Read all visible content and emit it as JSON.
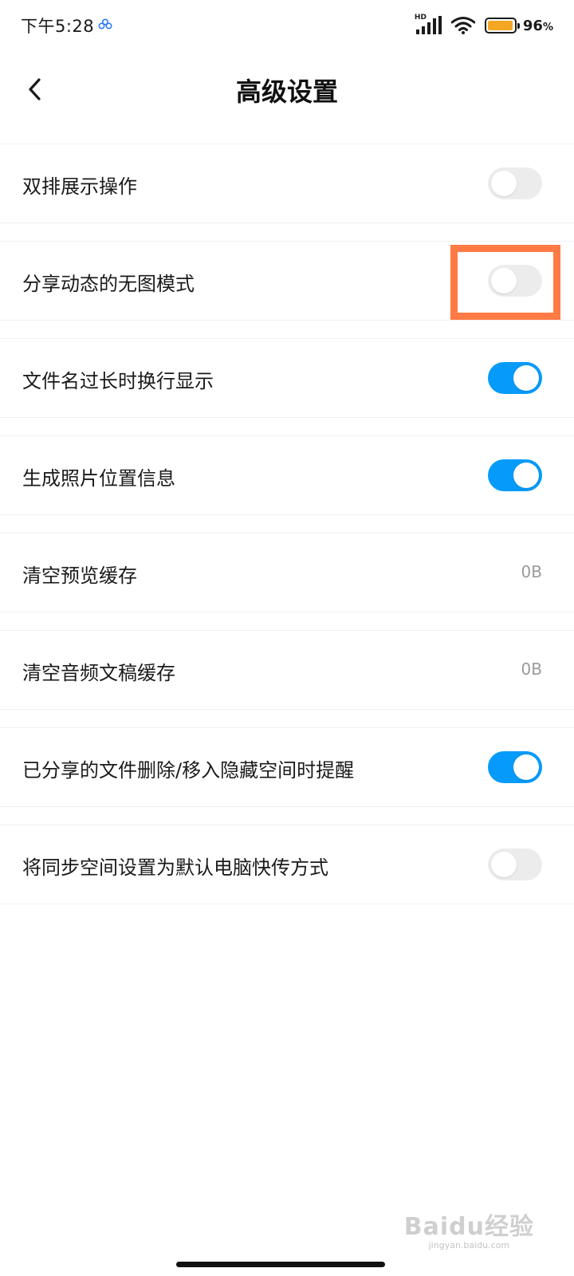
{
  "status_bar": {
    "time": "下午5:28",
    "network_label": "HD",
    "battery_percent": "96",
    "battery_percent_sign": "%",
    "battery_level": 0.96,
    "battery_color": "#f5a623"
  },
  "header": {
    "back_icon": "chevron-left-icon",
    "title": "高级设置"
  },
  "settings": [
    {
      "label": "双排展示操作",
      "type": "toggle",
      "on": false
    },
    {
      "label": "分享动态的无图模式",
      "type": "toggle",
      "on": false,
      "highlighted": true
    },
    {
      "label": "文件名过长时换行显示",
      "type": "toggle",
      "on": true
    },
    {
      "label": "生成照片位置信息",
      "type": "toggle",
      "on": true
    },
    {
      "label": "清空预览缓存",
      "type": "value",
      "value": "0B"
    },
    {
      "label": "清空音频文稿缓存",
      "type": "value",
      "value": "0B"
    },
    {
      "label": "已分享的文件删除/移入隐藏空间时提醒",
      "type": "toggle",
      "on": true
    },
    {
      "label": "将同步空间设置为默认电脑快传方式",
      "type": "toggle",
      "on": false
    }
  ],
  "colors": {
    "toggle_on": "#069bfa",
    "toggle_off": "#ececec",
    "highlight": "#ff7a45"
  },
  "watermark": {
    "logo": "Baidu经验",
    "url": "jingyan.baidu.com"
  }
}
